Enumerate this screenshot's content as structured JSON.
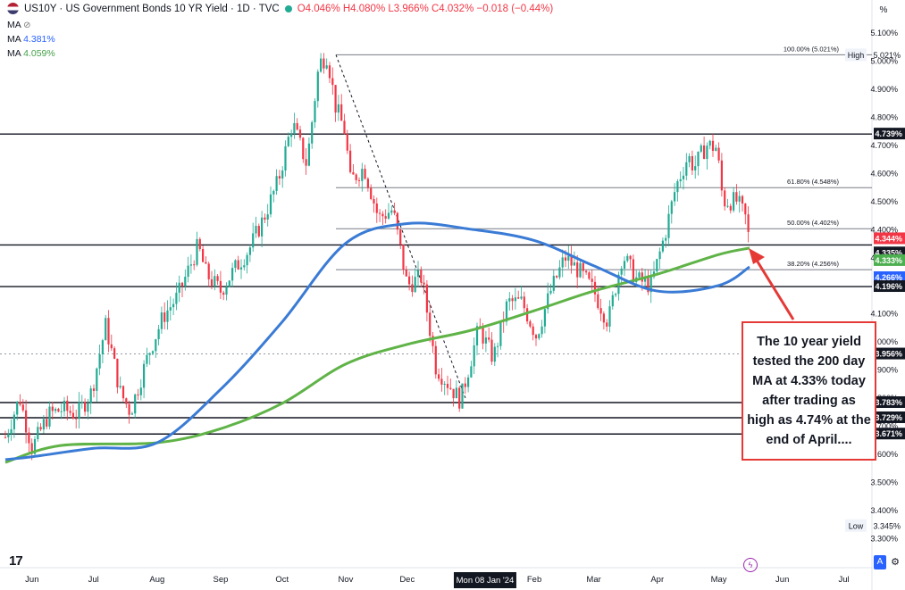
{
  "header": {
    "symbol_title": "US10Y · US Government Bonds 10 YR Yield · 1D · TVC",
    "open": "O4.046%",
    "high": "H4.080%",
    "low": "L3.966%",
    "close": "C4.032%",
    "change": "−0.018 (−0.44%)",
    "ma1_label": "MA",
    "ma1_value": "4.381%",
    "ma2_label": "MA",
    "ma2_value": "4.059%",
    "ma0_label": "MA",
    "percent_button": "%"
  },
  "colors": {
    "up": "#22ab94",
    "down": "#f23645",
    "ma100": "#3a7bd5",
    "ma200": "#5fb347",
    "axis_tag_dark": "#131722",
    "tag_red": "#f23645",
    "tag_blue": "#2962ff",
    "tag_green": "#4caf50",
    "callout_border": "#e53935",
    "arrow": "#e53935"
  },
  "callout_text": "The 10 year yield tested the 200 day MA at 4.33% today after trading as high as 4.74% at the end of April....",
  "chart_data": {
    "type": "candlestick",
    "ylim": [
      3.28,
      5.12
    ],
    "y_ticks": [
      "5.100%",
      "5.000%",
      "4.900%",
      "4.800%",
      "4.700%",
      "4.600%",
      "4.500%",
      "4.400%",
      "4.300%",
      "4.100%",
      "4.000%",
      "3.900%",
      "3.800%",
      "3.700%",
      "3.600%",
      "3.500%",
      "3.400%",
      "3.300%"
    ],
    "x_ticks": [
      "Jun",
      "Jul",
      "Aug",
      "Sep",
      "Oct",
      "Nov",
      "Dec",
      "Feb",
      "Mar",
      "Apr",
      "May",
      "Jun",
      "Jul"
    ],
    "crosshair_label": "Mon 08 Jan '24",
    "price_path": [
      {
        "date": "2023-05-19",
        "value": 3.66
      },
      {
        "date": "2023-05-26",
        "value": 3.8
      },
      {
        "date": "2023-06-01",
        "value": 3.62
      },
      {
        "date": "2023-06-09",
        "value": 3.74
      },
      {
        "date": "2023-06-16",
        "value": 3.76
      },
      {
        "date": "2023-06-23",
        "value": 3.74
      },
      {
        "date": "2023-06-30",
        "value": 3.82
      },
      {
        "date": "2023-07-07",
        "value": 4.06
      },
      {
        "date": "2023-07-14",
        "value": 3.82
      },
      {
        "date": "2023-07-19",
        "value": 3.75
      },
      {
        "date": "2023-07-28",
        "value": 3.96
      },
      {
        "date": "2023-08-04",
        "value": 4.09
      },
      {
        "date": "2023-08-11",
        "value": 4.16
      },
      {
        "date": "2023-08-21",
        "value": 4.34
      },
      {
        "date": "2023-08-25",
        "value": 4.24
      },
      {
        "date": "2023-09-01",
        "value": 4.18
      },
      {
        "date": "2023-09-08",
        "value": 4.26
      },
      {
        "date": "2023-09-15",
        "value": 4.33
      },
      {
        "date": "2023-09-22",
        "value": 4.44
      },
      {
        "date": "2023-09-29",
        "value": 4.57
      },
      {
        "date": "2023-10-06",
        "value": 4.78
      },
      {
        "date": "2023-10-13",
        "value": 4.63
      },
      {
        "date": "2023-10-19",
        "value": 4.99
      },
      {
        "date": "2023-10-23",
        "value": 5.02
      },
      {
        "date": "2023-10-27",
        "value": 4.84
      },
      {
        "date": "2023-11-01",
        "value": 4.74
      },
      {
        "date": "2023-11-03",
        "value": 4.57
      },
      {
        "date": "2023-11-10",
        "value": 4.62
      },
      {
        "date": "2023-11-17",
        "value": 4.44
      },
      {
        "date": "2023-11-24",
        "value": 4.47
      },
      {
        "date": "2023-12-01",
        "value": 4.2
      },
      {
        "date": "2023-12-08",
        "value": 4.23
      },
      {
        "date": "2023-12-15",
        "value": 3.91
      },
      {
        "date": "2023-12-27",
        "value": 3.79
      },
      {
        "date": "2024-01-05",
        "value": 4.05
      },
      {
        "date": "2024-01-12",
        "value": 3.94
      },
      {
        "date": "2024-01-19",
        "value": 4.14
      },
      {
        "date": "2024-01-26",
        "value": 4.14
      },
      {
        "date": "2024-02-02",
        "value": 4.02
      },
      {
        "date": "2024-02-09",
        "value": 4.18
      },
      {
        "date": "2024-02-16",
        "value": 4.3
      },
      {
        "date": "2024-02-23",
        "value": 4.25
      },
      {
        "date": "2024-03-01",
        "value": 4.18
      },
      {
        "date": "2024-03-08",
        "value": 4.07
      },
      {
        "date": "2024-03-15",
        "value": 4.31
      },
      {
        "date": "2024-03-22",
        "value": 4.22
      },
      {
        "date": "2024-03-29",
        "value": 4.2
      },
      {
        "date": "2024-04-05",
        "value": 4.39
      },
      {
        "date": "2024-04-10",
        "value": 4.55
      },
      {
        "date": "2024-04-16",
        "value": 4.66
      },
      {
        "date": "2024-04-19",
        "value": 4.62
      },
      {
        "date": "2024-04-25",
        "value": 4.7
      },
      {
        "date": "2024-04-30",
        "value": 4.69
      },
      {
        "date": "2024-05-03",
        "value": 4.5
      },
      {
        "date": "2024-05-10",
        "value": 4.5
      },
      {
        "date": "2024-05-14",
        "value": 4.44
      },
      {
        "date": "2024-05-16",
        "value": 4.35
      }
    ],
    "ma_100": [
      {
        "date": "2023-05-19",
        "value": 3.58
      },
      {
        "date": "2023-06-01",
        "value": 3.59
      },
      {
        "date": "2023-07-01",
        "value": 3.62
      },
      {
        "date": "2023-08-01",
        "value": 3.64
      },
      {
        "date": "2023-09-01",
        "value": 3.83
      },
      {
        "date": "2023-10-01",
        "value": 4.07
      },
      {
        "date": "2023-11-01",
        "value": 4.35
      },
      {
        "date": "2023-12-01",
        "value": 4.42
      },
      {
        "date": "2024-01-01",
        "value": 4.4
      },
      {
        "date": "2024-02-01",
        "value": 4.36
      },
      {
        "date": "2024-03-01",
        "value": 4.27
      },
      {
        "date": "2024-04-01",
        "value": 4.18
      },
      {
        "date": "2024-05-01",
        "value": 4.2
      },
      {
        "date": "2024-05-16",
        "value": 4.266
      }
    ],
    "ma_200": [
      {
        "date": "2023-05-19",
        "value": 3.57
      },
      {
        "date": "2023-06-15",
        "value": 3.63
      },
      {
        "date": "2023-08-01",
        "value": 3.64
      },
      {
        "date": "2023-09-01",
        "value": 3.69
      },
      {
        "date": "2023-10-01",
        "value": 3.78
      },
      {
        "date": "2023-11-01",
        "value": 3.92
      },
      {
        "date": "2023-12-01",
        "value": 3.99
      },
      {
        "date": "2024-01-01",
        "value": 4.04
      },
      {
        "date": "2024-02-01",
        "value": 4.11
      },
      {
        "date": "2024-03-01",
        "value": 4.18
      },
      {
        "date": "2024-04-01",
        "value": 4.24
      },
      {
        "date": "2024-05-01",
        "value": 4.31
      },
      {
        "date": "2024-05-16",
        "value": 4.333
      }
    ],
    "hlines": [
      {
        "value": 4.739,
        "label": "4.739%",
        "style": "solid"
      },
      {
        "value": 4.344,
        "label": "4.344%",
        "style": "solid"
      },
      {
        "value": 4.196,
        "label": "4.196%",
        "style": "solid"
      },
      {
        "value": 3.783,
        "label": "3.783%",
        "style": "solid"
      },
      {
        "value": 3.729,
        "label": "3.729%",
        "style": "solid"
      },
      {
        "value": 3.671,
        "label": "3.671%",
        "style": "solid"
      }
    ],
    "fibs": [
      {
        "value": 5.021,
        "label": "100.00% (5.021%)"
      },
      {
        "value": 4.548,
        "label": "61.80% (4.548%)"
      },
      {
        "value": 4.402,
        "label": "50.00% (4.402%)"
      },
      {
        "value": 4.256,
        "label": "38.20% (4.256%)"
      }
    ],
    "axis_tags": [
      {
        "value": 5.021,
        "label": "5.021%",
        "kind": "high",
        "prefix": "High"
      },
      {
        "value": 4.739,
        "label": "4.739%",
        "kind": "dark"
      },
      {
        "value": 4.344,
        "label": "4.344%",
        "kind": "red"
      },
      {
        "value": 4.335,
        "label": "4.335%",
        "kind": "dark"
      },
      {
        "value": 4.333,
        "label": "4.333%",
        "kind": "green"
      },
      {
        "value": 4.266,
        "label": "4.266%",
        "kind": "blue"
      },
      {
        "value": 4.196,
        "label": "4.196%",
        "kind": "dark"
      },
      {
        "value": 3.956,
        "label": "3.956%",
        "kind": "dark"
      },
      {
        "value": 3.783,
        "label": "3.783%",
        "kind": "dark"
      },
      {
        "value": 3.729,
        "label": "3.729%",
        "kind": "dark"
      },
      {
        "value": 3.671,
        "label": "3.671%",
        "kind": "dark"
      },
      {
        "value": 3.345,
        "label": "3.345%",
        "kind": "low",
        "prefix": "Low"
      }
    ],
    "dashed_line": {
      "value": 3.956
    }
  }
}
